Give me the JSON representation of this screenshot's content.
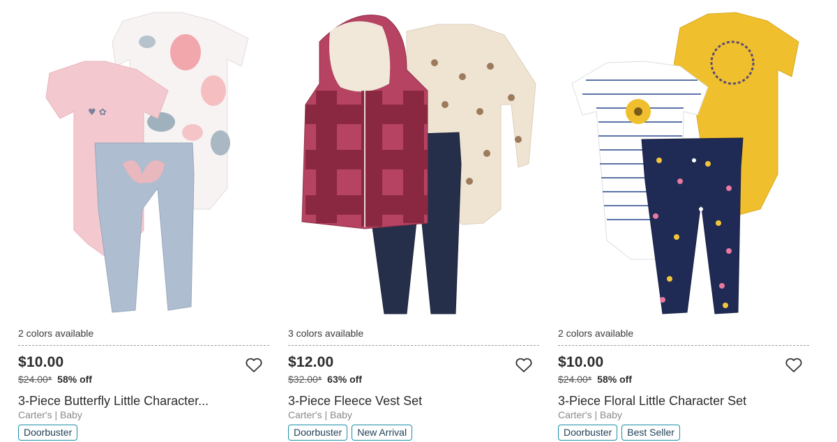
{
  "products": [
    {
      "colors": "2 colors available",
      "price": "$10.00",
      "was": "$24.00*",
      "off": "58% off",
      "title": "3-Piece Butterfly Little Character...",
      "brand": "Carter's | Baby",
      "badges": [
        "Doorbuster"
      ]
    },
    {
      "colors": "3 colors available",
      "price": "$12.00",
      "was": "$32.00*",
      "off": "63% off",
      "title": "3-Piece Fleece Vest Set",
      "brand": "Carter's | Baby",
      "badges": [
        "Doorbuster",
        "New Arrival"
      ]
    },
    {
      "colors": "2 colors available",
      "price": "$10.00",
      "was": "$24.00*",
      "off": "58% off",
      "title": "3-Piece Floral Little Character Set",
      "brand": "Carter's | Baby",
      "badges": [
        "Doorbuster",
        "Best Seller"
      ]
    }
  ],
  "icons": {
    "wishlist": "heart-outline-icon"
  },
  "colors": {
    "badge_border": "#1a8ea8",
    "text": "#2b2b2b",
    "muted": "#8a8a8a"
  }
}
